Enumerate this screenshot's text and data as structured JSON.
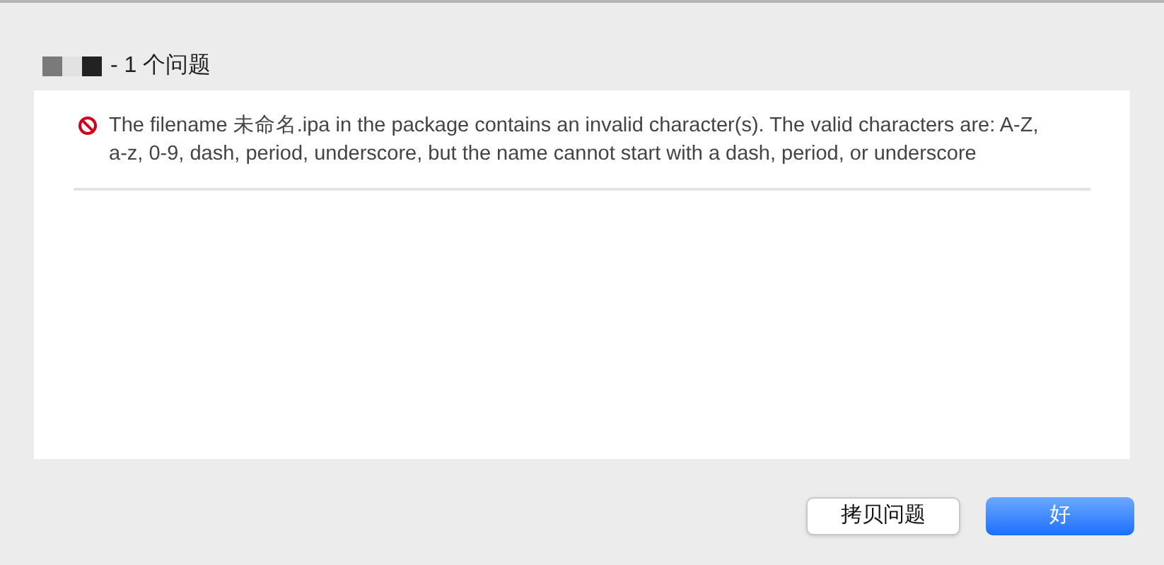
{
  "title": "- 1 个问题",
  "issues": [
    {
      "kind": "error",
      "message": "The filename 未命名.ipa in the package contains an invalid character(s).  The valid characters are: A-Z, a-z, 0-9, dash, period, underscore, but the name cannot start with a dash, period, or underscore"
    }
  ],
  "buttons": [
    {
      "label": "拷贝问题",
      "default": false
    },
    {
      "label": "好",
      "default": true
    }
  ]
}
